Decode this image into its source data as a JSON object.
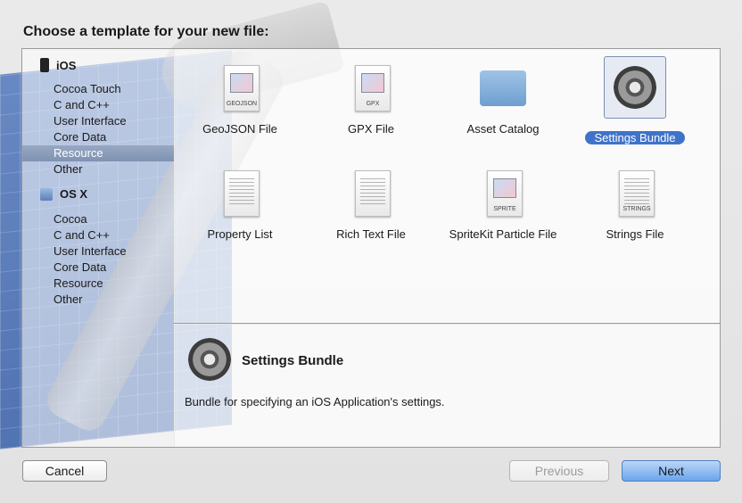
{
  "title": "Choose a template for your new file:",
  "sidebar": {
    "sections": [
      {
        "name": "iOS",
        "icon": "iphone-icon"
      },
      {
        "name": "OS X",
        "icon": "mac-icon"
      }
    ],
    "ios_items": [
      "Cocoa Touch",
      "C and C++",
      "User Interface",
      "Core Data",
      "Resource",
      "Other"
    ],
    "osx_items": [
      "Cocoa",
      "C and C++",
      "User Interface",
      "Core Data",
      "Resource",
      "Other"
    ],
    "selected": "Resource"
  },
  "templates": [
    {
      "label": "GeoJSON File",
      "icon": "geojson-doc-icon",
      "tag": "GEOJSON"
    },
    {
      "label": "GPX File",
      "icon": "gpx-doc-icon",
      "tag": "GPX"
    },
    {
      "label": "Asset Catalog",
      "icon": "folder-icon",
      "tag": ""
    },
    {
      "label": "Settings Bundle",
      "icon": "gear-icon",
      "tag": ""
    },
    {
      "label": "Property List",
      "icon": "plist-doc-icon",
      "tag": ""
    },
    {
      "label": "Rich Text File",
      "icon": "rtf-doc-icon",
      "tag": ""
    },
    {
      "label": "SpriteKit Particle File",
      "icon": "sprite-doc-icon",
      "tag": "SPRITE"
    },
    {
      "label": "Strings File",
      "icon": "strings-doc-icon",
      "tag": "STRINGS"
    }
  ],
  "selected_template": "Settings Bundle",
  "detail": {
    "title": "Settings Bundle",
    "description": "Bundle for specifying an iOS Application's settings."
  },
  "buttons": {
    "cancel": "Cancel",
    "previous": "Previous",
    "next": "Next"
  },
  "colors": {
    "selection_blue": "#3f73c9",
    "sidebar_selection": "#8a9cb9"
  }
}
